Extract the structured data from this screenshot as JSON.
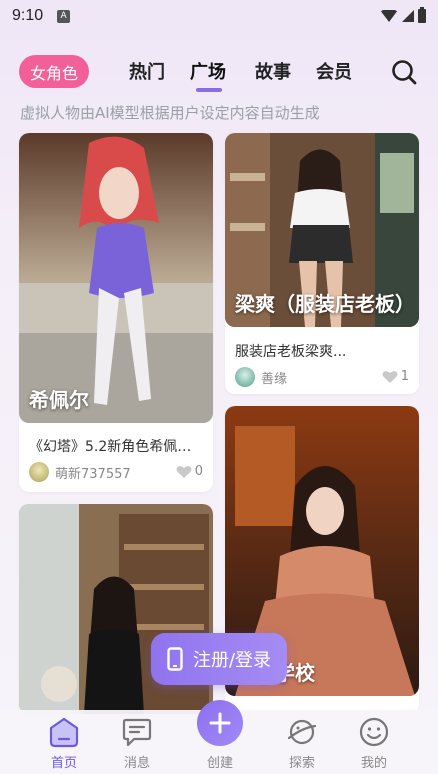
{
  "status_bar": {
    "time": "9:10",
    "notification_glyph": "A"
  },
  "header": {
    "role_pill": "女角色",
    "tabs": [
      {
        "label": "热门"
      },
      {
        "label": "广场"
      },
      {
        "label": "故事"
      },
      {
        "label": "会员"
      }
    ],
    "active_tab": "广场",
    "subtitle": "虚拟人物由AI模型根据用户设定内容自动生成"
  },
  "cards": [
    {
      "title": "希佩尔",
      "description": "《幻塔》5.2新角色希佩尔...",
      "author": "萌新737557",
      "likes": "0"
    },
    {
      "title": "梁爽（服装店老板）",
      "description": "服装店老板梁爽...",
      "author": "善缘",
      "likes": "1"
    },
    {
      "title": "",
      "description": "",
      "author": "",
      "likes": ""
    },
    {
      "title": "女子学校",
      "description": "",
      "author": "",
      "likes": ""
    }
  ],
  "cta": {
    "label": "注册/登录"
  },
  "bottom_nav": {
    "items": [
      {
        "label": "首页",
        "icon": "home-icon"
      },
      {
        "label": "消息",
        "icon": "message-icon"
      },
      {
        "label": "创建",
        "icon": "plus-icon"
      },
      {
        "label": "探索",
        "icon": "planet-icon"
      },
      {
        "label": "我的",
        "icon": "smiley-icon"
      }
    ],
    "active": "首页"
  },
  "colors": {
    "accent": "#8a6de4",
    "pill": "#f2609a",
    "active_nav": "#6b5ae0"
  }
}
